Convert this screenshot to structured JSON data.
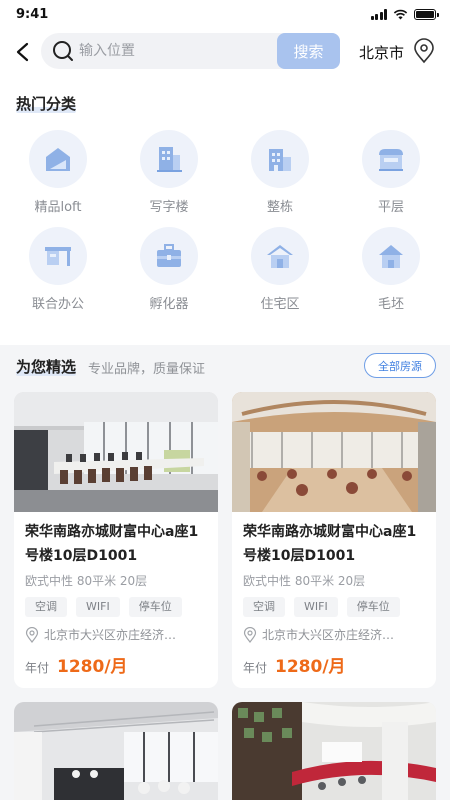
{
  "status": {
    "time": "9:41"
  },
  "search": {
    "placeholder": "输入位置",
    "button": "搜索",
    "city": "北京市"
  },
  "hot": {
    "title": "热门分类",
    "categories": [
      {
        "label": "精品loft",
        "icon": "loft-icon"
      },
      {
        "label": "写字楼",
        "icon": "office-building-icon"
      },
      {
        "label": "整栋",
        "icon": "whole-building-icon"
      },
      {
        "label": "平层",
        "icon": "flat-floor-icon"
      },
      {
        "label": "联合办公",
        "icon": "coworking-desk-icon"
      },
      {
        "label": "孵化器",
        "icon": "incubator-briefcase-icon"
      },
      {
        "label": "住宅区",
        "icon": "residential-house-icon"
      },
      {
        "label": "毛坯",
        "icon": "unfinished-house-icon"
      }
    ]
  },
  "picks": {
    "title": "为您精选",
    "subtitle": "专业品牌，质量保证",
    "all_button": "全部房源",
    "cards": [
      {
        "title": "荣华南路亦城财富中心a座1号楼10层D1001",
        "meta": "欧式中性 80平米 20层",
        "tags": [
          "空调",
          "WIFI",
          "停车位"
        ],
        "address": "北京市大兴区亦庄经济…",
        "pay": "年付",
        "price": "1280/月"
      },
      {
        "title": "荣华南路亦城财富中心a座1号楼10层D1001",
        "meta": "欧式中性 80平米 20层",
        "tags": [
          "空调",
          "WIFI",
          "停车位"
        ],
        "address": "北京市大兴区亦庄经济…",
        "pay": "年付",
        "price": "1280/月"
      }
    ]
  },
  "colors": {
    "accent": "#3f7fe0",
    "price": "#ee6a19",
    "search_button": "#a9c3ee"
  }
}
